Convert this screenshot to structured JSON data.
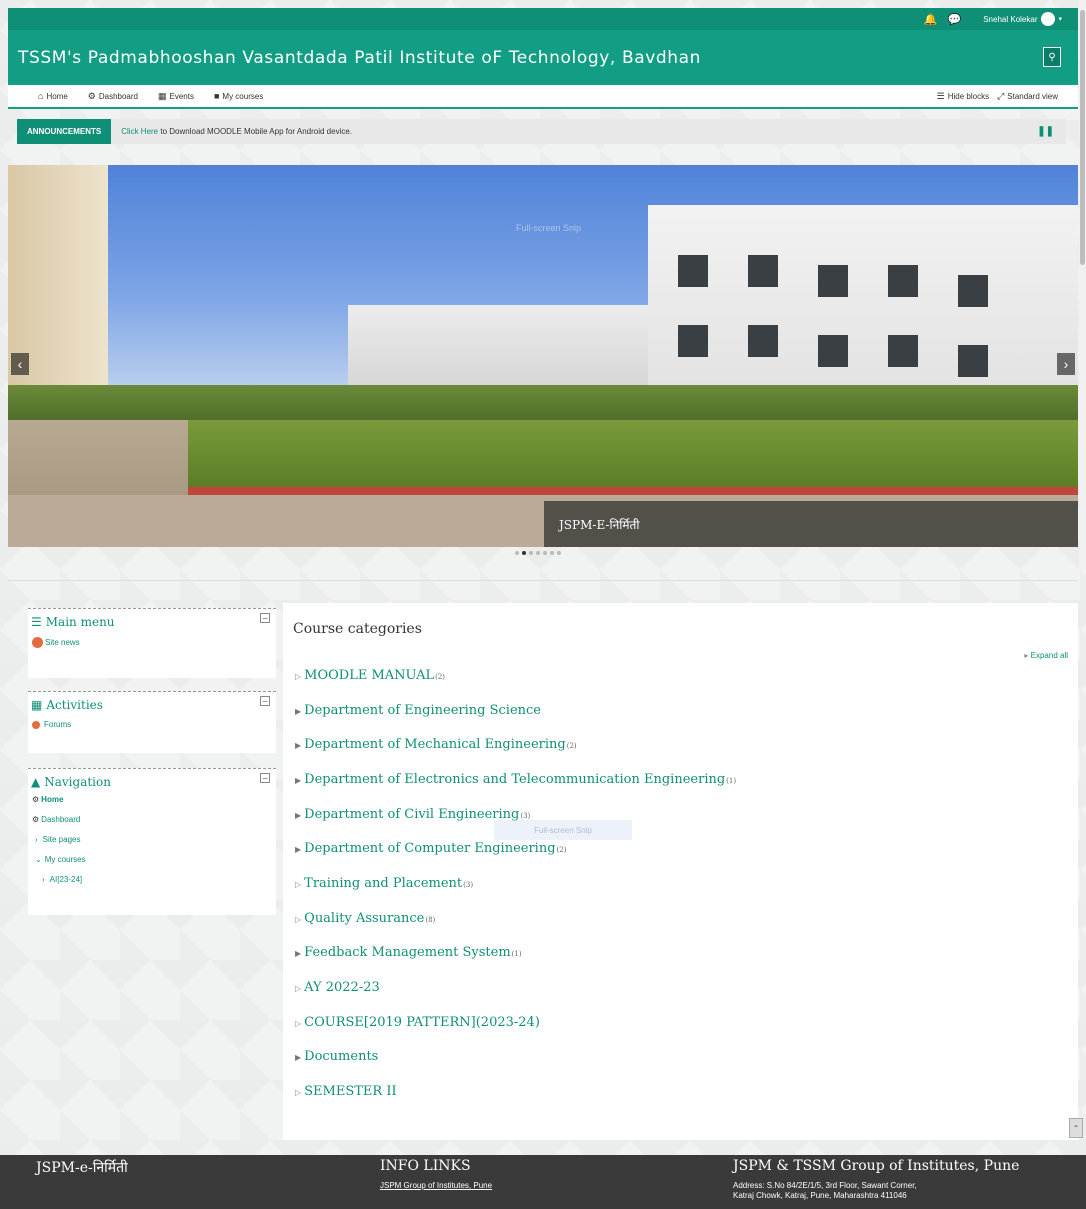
{
  "topbar": {
    "user_name": "Snehal Kolekar"
  },
  "brand": {
    "title": "TSSM's Padmabhooshan Vasantdada Patil Institute oF Technology, Bavdhan"
  },
  "nav": {
    "items": [
      {
        "label": "Home",
        "icon": "home-icon"
      },
      {
        "label": "Dashboard",
        "icon": "dashboard-icon"
      },
      {
        "label": "Events",
        "icon": "calendar-icon"
      },
      {
        "label": "My courses",
        "icon": "courses-icon"
      }
    ],
    "hide_blocks": "Hide blocks",
    "standard_view": "Standard view"
  },
  "announcement": {
    "label": "ANNOUNCEMENTS",
    "link_text": "Click Here",
    "message": " to Download MOODLE Mobile App for Android device."
  },
  "slider": {
    "caption": "JSPM-E-निर्मिती",
    "overlay_text": "Full-screen Snip",
    "dots_total": 7,
    "active_dot": 2
  },
  "blocks": {
    "main_menu": {
      "title": "Main menu",
      "items": [
        "Site news"
      ]
    },
    "activities": {
      "title": "Activities",
      "items": [
        "Forums"
      ]
    },
    "navigation": {
      "title": "Navigation",
      "items": [
        "Home",
        "Dashboard",
        "Site pages",
        "My courses",
        "AI[23-24]"
      ]
    }
  },
  "main": {
    "heading": "Course categories",
    "expand_all": "Expand all",
    "categories": [
      {
        "name": "MOODLE MANUAL",
        "count": "(2)"
      },
      {
        "name": "Department of Engineering Science",
        "count": ""
      },
      {
        "name": "Department of Mechanical Engineering",
        "count": "(2)"
      },
      {
        "name": "Department of Electronics and Telecommunication Engineering",
        "count": "(1)"
      },
      {
        "name": "Department of Civil Engineering",
        "count": "(3)"
      },
      {
        "name": "Department of Computer Engineering",
        "count": "(2)"
      },
      {
        "name": "Training and Placement",
        "count": "(3)"
      },
      {
        "name": "Quality Assurance",
        "count": "(8)"
      },
      {
        "name": "Feedback Management System",
        "count": "(1)"
      },
      {
        "name": "AY 2022-23",
        "count": ""
      },
      {
        "name": "COURSE[2019 PATTERN](2023-24)",
        "count": ""
      },
      {
        "name": "Documents",
        "count": ""
      },
      {
        "name": "SEMESTER II",
        "count": ""
      }
    ],
    "overlay_text": "Full-screen Snip"
  },
  "footer": {
    "col1_title": "JSPM-e-निर्मिती",
    "col2_title": "INFO LINKS",
    "col2_link": "JSPM Group of Institutes, Pune",
    "col3_title": "JSPM & TSSM Group of Institutes, Pune",
    "col3_addr_line1": "Address: S.No 84/2E/1/5, 3rd Floor, Sawant Corner,",
    "col3_addr_line2": "Katraj Chowk, Katraj, Pune, Maharashtra 411046"
  },
  "colors": {
    "brand": "#129e84",
    "brand_dark": "#0f8f76",
    "footer": "#3a3a3a"
  }
}
